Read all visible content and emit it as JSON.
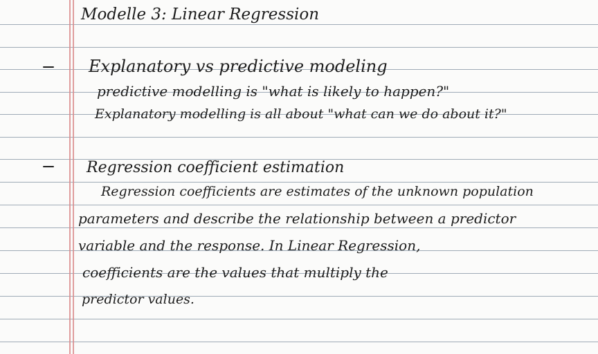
{
  "notes": {
    "title": "Modelle 3: Linear Regression",
    "sections": [
      {
        "heading": "Explanatory vs predictive modeling",
        "lines": [
          "predictive modelling is \"what is likely to happen?\"",
          "Explanatory modelling is all about \"what can we do about it?\""
        ]
      },
      {
        "heading": "Regression coefficient estimation",
        "lines": [
          "Regression coefficients are estimates of the unknown population",
          "parameters and describe the relationship between a predictor",
          "variable and the response. In Linear Regression,",
          "coefficients are the values that multiply the",
          "predictor values."
        ]
      }
    ]
  },
  "colors": {
    "paper": "#fbfbfa",
    "rule_lines": "#7f8f9f",
    "margin_line": "#d98c8c",
    "ink": "#1c1c1c"
  }
}
